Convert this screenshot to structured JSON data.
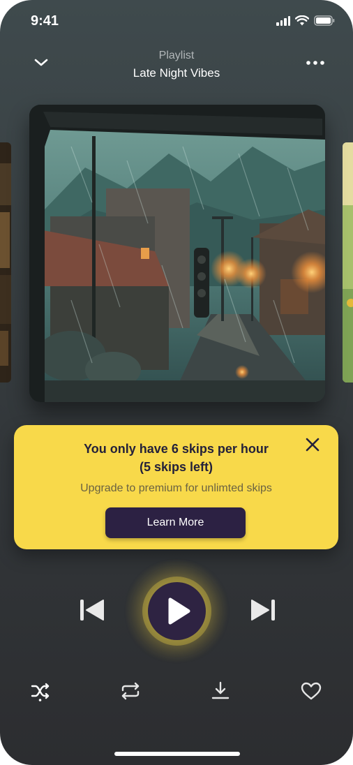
{
  "status_bar": {
    "time": "9:41"
  },
  "header": {
    "subtitle": "Playlist",
    "title": "Late Night Vibes"
  },
  "toast": {
    "line1": "You only have 6 skips per hour",
    "line2": "(5 skips left)",
    "message": "Upgrade to premium for unlimted skips",
    "button_label": "Learn More"
  },
  "controls": [
    "shuffle-icon",
    "repeat-icon",
    "download-icon",
    "heart-icon"
  ],
  "colors": {
    "accent_yellow": "#f8d94a",
    "button_dark": "#2c2143",
    "play_bg": "#2e2342"
  }
}
